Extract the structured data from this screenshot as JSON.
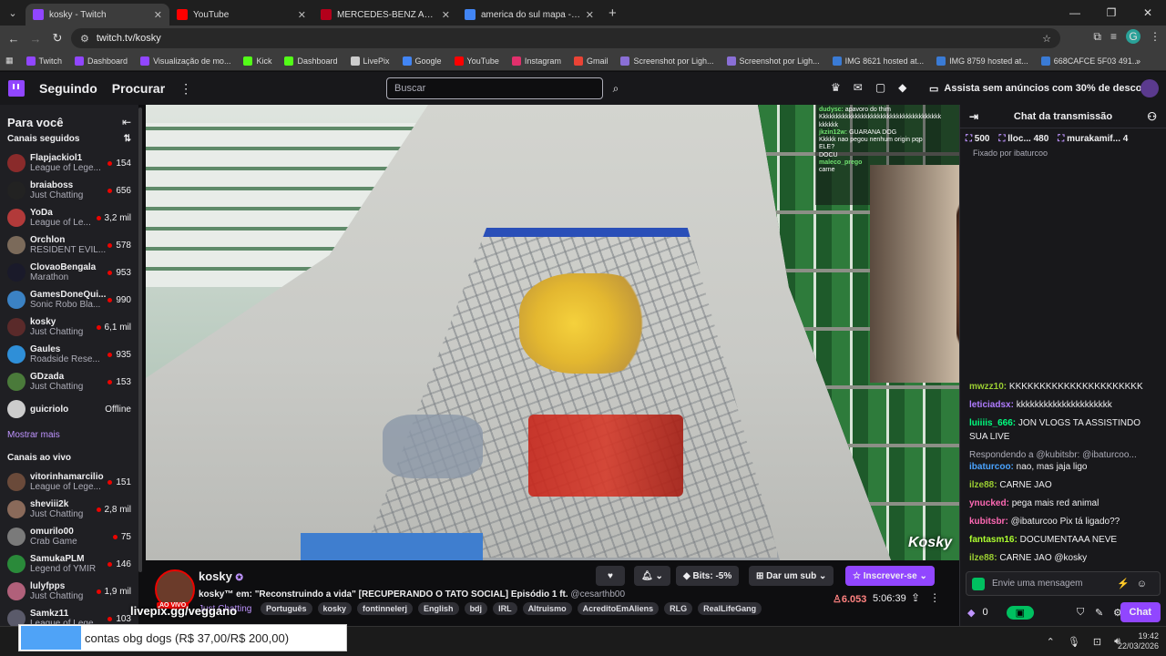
{
  "browser": {
    "tabs": [
      {
        "title": "kosky - Twitch",
        "color": "#9146ff",
        "active": true
      },
      {
        "title": "YouTube",
        "color": "#ff0000",
        "active": false
      },
      {
        "title": "MERCEDES-BENZ AMG GT 63 4",
        "color": "#b3001b",
        "active": false
      },
      {
        "title": "america do sul mapa - Pesquis",
        "color": "#4285f4",
        "active": false
      }
    ],
    "url": "twitch.tv/kosky",
    "bookmarks": [
      {
        "label": "Twitch",
        "color": "#9146ff"
      },
      {
        "label": "Dashboard",
        "color": "#9146ff"
      },
      {
        "label": "Visualização de mo...",
        "color": "#9146ff"
      },
      {
        "label": "Kick",
        "color": "#53fc18"
      },
      {
        "label": "Dashboard",
        "color": "#53fc18"
      },
      {
        "label": "LivePix",
        "color": "#cccccc"
      },
      {
        "label": "Google",
        "color": "#4285f4"
      },
      {
        "label": "YouTube",
        "color": "#ff0000"
      },
      {
        "label": "Instagram",
        "color": "#e1306c"
      },
      {
        "label": "Gmail",
        "color": "#ea4335"
      },
      {
        "label": "Screenshot por Ligh...",
        "color": "#8a6fd6"
      },
      {
        "label": "Screenshot por Ligh...",
        "color": "#8a6fd6"
      },
      {
        "label": "IMG 8621 hosted at...",
        "color": "#3a7bd5"
      },
      {
        "label": "IMG 8759 hosted at...",
        "color": "#3a7bd5"
      },
      {
        "label": "668CAFCE 5F03 491...",
        "color": "#3a7bd5"
      }
    ],
    "profile_initial": "G"
  },
  "twitch_nav": {
    "following": "Seguindo",
    "browse": "Procurar",
    "search_placeholder": "Buscar",
    "prime_text": "Assista sem anúncios com 30% de desconto"
  },
  "sidebar": {
    "title": "Para você",
    "followed_title": "Canais seguidos",
    "followed": [
      {
        "name": "Flapjackiol1",
        "game": "League of Lege...",
        "viewers": "154",
        "color": "#8a2b2b"
      },
      {
        "name": "braiaboss",
        "game": "Just Chatting",
        "viewers": "656",
        "color": "#222222"
      },
      {
        "name": "YoDa",
        "game": "League of Le...",
        "viewers": "3,2 mil",
        "color": "#b23a3a"
      },
      {
        "name": "Orchlon",
        "game": "RESIDENT EVIL...",
        "viewers": "578",
        "color": "#7b6a5a"
      },
      {
        "name": "ClovaoBengala",
        "game": "Marathon",
        "viewers": "953",
        "color": "#1a1a2a"
      },
      {
        "name": "GamesDoneQui...",
        "game": "Sonic Robo Bla...",
        "viewers": "990",
        "color": "#3b82c4"
      },
      {
        "name": "kosky",
        "game": "Just Chatting",
        "viewers": "6,1 mil",
        "color": "#5a2a2a"
      },
      {
        "name": "Gaules",
        "game": "Roadside Rese...",
        "viewers": "935",
        "color": "#2f8fd8"
      },
      {
        "name": "GDzada",
        "game": "Just Chatting",
        "viewers": "153",
        "color": "#4a7a3a"
      },
      {
        "name": "guicriolo",
        "game": "",
        "viewers": "Offline",
        "color": "#cccccc"
      }
    ],
    "show_more": "Mostrar mais",
    "live_title": "Canais ao vivo",
    "live": [
      {
        "name": "vitorinhamarcilio",
        "game": "League of Lege...",
        "viewers": "151",
        "color": "#6a4a3a"
      },
      {
        "name": "sheviii2k",
        "game": "Just Chatting",
        "viewers": "2,8 mil",
        "color": "#8a6a5a"
      },
      {
        "name": "omurilo00",
        "game": "Crab Game",
        "viewers": "75",
        "color": "#7a7a7a"
      },
      {
        "name": "SamukaPLM",
        "game": "Legend of YMIR",
        "viewers": "146",
        "color": "#2a8a3a"
      },
      {
        "name": "lulyfpps",
        "game": "Just Chatting",
        "viewers": "1,9 mil",
        "color": "#b0607a"
      },
      {
        "name": "Samkz11",
        "game": "League of Lege...",
        "viewers": "103",
        "color": "#5a5a6a"
      }
    ]
  },
  "video": {
    "watermark": "Kosky",
    "overlay_chat": [
      {
        "user": "dudysc:",
        "text": "apavoro do thim"
      },
      {
        "user": "",
        "text": "Kkkkkkkkkkkkkkkkkkkkkkkkkkkkkkkkkkkkkk kkkkkk"
      },
      {
        "user": "jkzin12w:",
        "text": "GUARANA DOG"
      },
      {
        "user": "",
        "text": "Kkkkk nao pegou nenhum origin pqp"
      },
      {
        "user": "",
        "text": "ELE?"
      },
      {
        "user": "",
        "text": "DOCU"
      },
      {
        "user": "maleco_prego",
        "text": ""
      },
      {
        "user": "",
        "text": "carne"
      }
    ]
  },
  "chat": {
    "header": "Chat da transmissão",
    "leaderboard": [
      {
        "name": "",
        "value": "500"
      },
      {
        "name": "lloc...",
        "value": "480"
      },
      {
        "name": "murakamif...",
        "value": "4"
      }
    ],
    "pinned": "Fixado por ibaturcoo",
    "messages": [
      {
        "user": "mwzz10:",
        "text": "KKKKKKKKKKKKKKKKKKKKKK",
        "color": "#9acd32",
        "reply": ""
      },
      {
        "user": "leticiadsx:",
        "text": "kkkkkkkkkkkkkkkkkkkkk",
        "color": "#b07cff",
        "reply": ""
      },
      {
        "user": "luiiiis_666:",
        "text": "JON VLOGS TA ASSISTINDO SUA LIVE",
        "color": "#00ff7f",
        "reply": ""
      },
      {
        "user": "ibaturcoo:",
        "text": "nao, mas jaja ligo",
        "color": "#4aa3ff",
        "reply": "Respondendo a @kubitsbr: @ibaturcoo..."
      },
      {
        "user": "ilze88:",
        "text": "CARNE JAO",
        "color": "#9acd32",
        "reply": ""
      },
      {
        "user": "ynucked:",
        "text": "pega mais red animal",
        "color": "#ff69b4",
        "reply": ""
      },
      {
        "user": "kubitsbr:",
        "text": "@ibaturcoo Pix tá ligado??",
        "color": "#ff69b4",
        "reply": ""
      },
      {
        "user": "fantasm16:",
        "text": "DOCUMENTAAA NEVE",
        "color": "#adff2f",
        "reply": ""
      },
      {
        "user": "ilze88:",
        "text": "CARNE JAO @kosky",
        "color": "#9acd32",
        "reply": ""
      }
    ],
    "input_placeholder": "Envie uma mensagem",
    "points": "0",
    "chat_button": "Chat"
  },
  "stream": {
    "streamer": "kosky",
    "live_badge": "AO VIVO",
    "title": "kosky™ em: \"Reconstruindo a vida\" [RECUPERANDO O TATO SOCIAL] Episódio 1 ft.",
    "mention": "@cesarthb00",
    "category": "Just Chatting",
    "tags": [
      "Português",
      "kosky",
      "fontinnelerj",
      "English",
      "bdj",
      "IRL",
      "Altruismo",
      "AcreditoEmAliens",
      "RLG",
      "RealLifeGang"
    ],
    "bits_label": "Bits: -5%",
    "gift_label": "Dar um sub",
    "subscribe_label": "Inscrever-se",
    "viewers": "6.053",
    "uptime": "5:06:39"
  },
  "livepix": {
    "url": "livepix.gg/veggano",
    "donation_text": "contas obg dogs (R$ 37,00/R$ 200,00)"
  },
  "taskbar": {
    "time": "19:42",
    "date": "22/03/2026"
  }
}
